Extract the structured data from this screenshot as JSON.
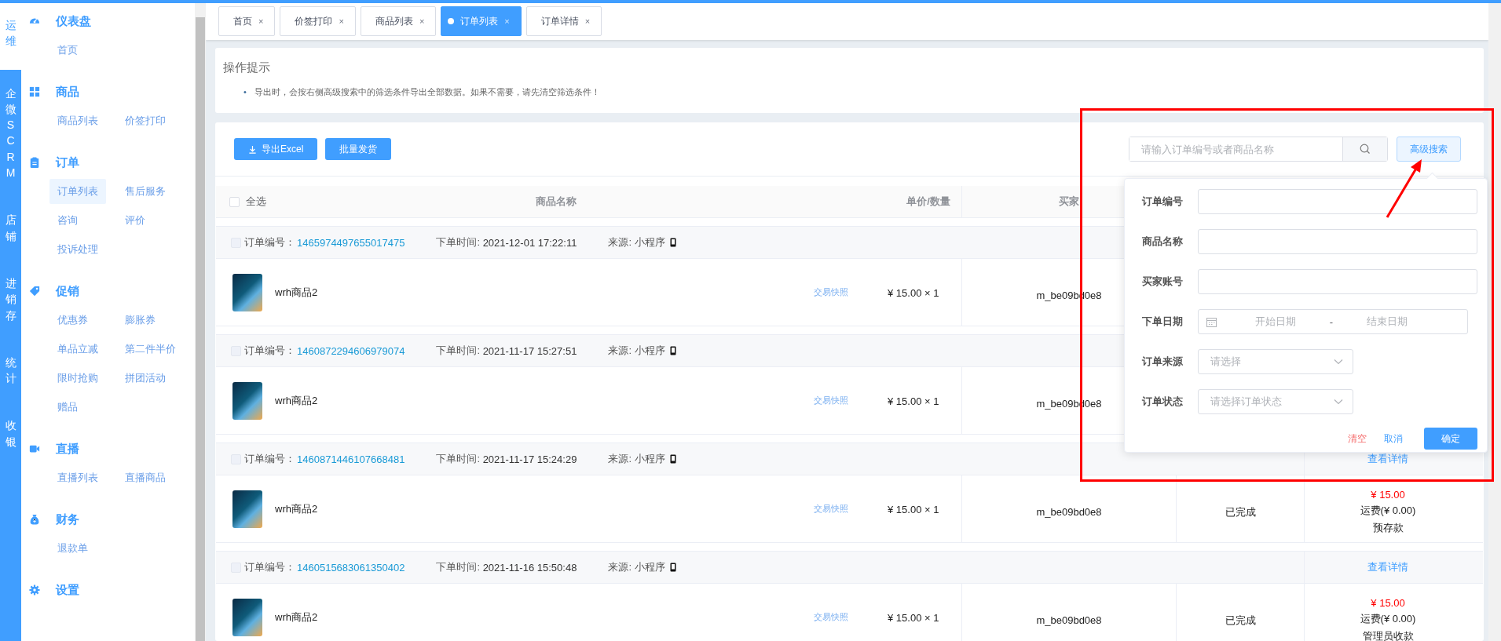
{
  "rail": [
    {
      "label": "运维",
      "selected": true
    },
    {
      "label": "企微SCRM",
      "selected": false
    },
    {
      "label": "店铺",
      "selected": false
    },
    {
      "label": "进销存",
      "selected": false
    },
    {
      "label": "统计",
      "selected": false
    },
    {
      "label": "收银",
      "selected": false
    }
  ],
  "sidebar": {
    "groups": [
      {
        "kind": "dashboard",
        "title": "仪表盘",
        "items": [
          {
            "label": "首页",
            "selected": false
          }
        ]
      },
      {
        "kind": "grid",
        "title": "商品",
        "items": [
          {
            "label": "商品列表",
            "selected": false
          },
          {
            "label": "价签打印",
            "selected": false
          }
        ]
      },
      {
        "kind": "clipboard",
        "title": "订单",
        "items": [
          {
            "label": "订单列表",
            "selected": true
          },
          {
            "label": "售后服务",
            "selected": false
          },
          {
            "label": "咨询",
            "selected": false
          },
          {
            "label": "评价",
            "selected": false
          },
          {
            "label": "投诉处理",
            "selected": false
          }
        ]
      },
      {
        "kind": "tag",
        "title": "促销",
        "items": [
          {
            "label": "优惠券",
            "selected": false
          },
          {
            "label": "膨胀券",
            "selected": false
          },
          {
            "label": "单品立减",
            "selected": false
          },
          {
            "label": "第二件半价",
            "selected": false
          },
          {
            "label": "限时抢购",
            "selected": false
          },
          {
            "label": "拼团活动",
            "selected": false
          },
          {
            "label": "赠品",
            "selected": false
          }
        ]
      },
      {
        "kind": "video",
        "title": "直播",
        "items": [
          {
            "label": "直播列表",
            "selected": false
          },
          {
            "label": "直播商品",
            "selected": false
          }
        ]
      },
      {
        "kind": "moneybag",
        "title": "财务",
        "items": [
          {
            "label": "退款单",
            "selected": false
          }
        ]
      },
      {
        "kind": "gear",
        "title": "设置"
      }
    ]
  },
  "tabs": [
    {
      "label": "首页",
      "close": "×",
      "selected": false
    },
    {
      "label": "价签打印",
      "close": "×",
      "selected": false
    },
    {
      "label": "商品列表",
      "close": "×",
      "selected": false
    },
    {
      "label": "订单列表",
      "close": "×",
      "selected": true
    },
    {
      "label": "订单详情",
      "close": "×",
      "selected": false
    }
  ],
  "tips": {
    "title": "操作提示",
    "bullet": "•",
    "items": [
      "导出时，会按右侧高级搜索中的筛选条件导出全部数据。如果不需要，请先清空筛选条件！"
    ]
  },
  "toolbar": {
    "buttons": [
      {
        "label": "导出Excel",
        "kind": "export"
      },
      {
        "label": "批量发货",
        "kind": "plain"
      }
    ],
    "search": {
      "placeholder": "请输入订单编号或者商品名称"
    },
    "advanced_button": "高级搜索"
  },
  "table": {
    "select_all": {
      "label": "全选",
      "checked": false
    },
    "columns": [
      "商品名称",
      "单价/数量",
      "买家"
    ]
  },
  "orders": [
    {
      "checked": false,
      "id_label": "订单编号：",
      "id": "1465974497655017475",
      "time_label": "下单时间:",
      "time": "2021-12-01 17:22:11",
      "source_label": "来源:",
      "source": "小程序",
      "product": "wrh商品2",
      "snapshot": "交易快照",
      "price": "¥ 15.00 × 1",
      "buyer": "m_be09bd0e8"
    },
    {
      "checked": false,
      "id_label": "订单编号：",
      "id": "1460872294606979074",
      "time_label": "下单时间:",
      "time": "2021-11-17 15:27:51",
      "source_label": "来源:",
      "source": "小程序",
      "product": "wrh商品2",
      "snapshot": "交易快照",
      "price": "¥ 15.00 × 1",
      "buyer": "m_be09bd0e8"
    },
    {
      "checked": false,
      "id_label": "订单编号：",
      "id": "1460871446107668481",
      "time_label": "下单时间:",
      "time": "2021-11-17 15:24:29",
      "source_label": "来源:",
      "source": "小程序",
      "detail": "查看详情",
      "product": "wrh商品2",
      "snapshot": "交易快照",
      "price": "¥ 15.00 × 1",
      "buyer": "m_be09bd0e8",
      "status": "已完成",
      "amount": "¥ 15.00",
      "freight": "运费(¥ 0.00)",
      "payment": "预存款"
    },
    {
      "checked": false,
      "id_label": "订单编号：",
      "id": "1460515683061350402",
      "time_label": "下单时间:",
      "time": "2021-11-16 15:50:48",
      "source_label": "来源:",
      "source": "小程序",
      "detail": "查看详情",
      "product": "wrh商品2",
      "snapshot": "交易快照",
      "price": "¥ 15.00 × 1",
      "buyer": "m_be09bd0e8",
      "status": "已完成",
      "amount": "¥ 15.00",
      "freight": "运费(¥ 0.00)",
      "payment": "管理员收款"
    }
  ],
  "advanced_search": {
    "fields": [
      {
        "kind": "text",
        "label": "订单编号"
      },
      {
        "kind": "text",
        "label": "商品名称"
      },
      {
        "kind": "text",
        "label": "买家账号"
      },
      {
        "kind": "daterange",
        "label": "下单日期",
        "start_placeholder": "开始日期",
        "separator": "-",
        "end_placeholder": "结束日期"
      },
      {
        "kind": "select",
        "label": "订单来源",
        "placeholder": "请选择"
      },
      {
        "kind": "select",
        "label": "订单状态",
        "placeholder": "请选择订单状态"
      }
    ],
    "actions": [
      {
        "label": "清空",
        "kind": "danger"
      },
      {
        "label": "取消",
        "kind": "link"
      },
      {
        "label": "确定",
        "kind": "primary"
      }
    ]
  }
}
